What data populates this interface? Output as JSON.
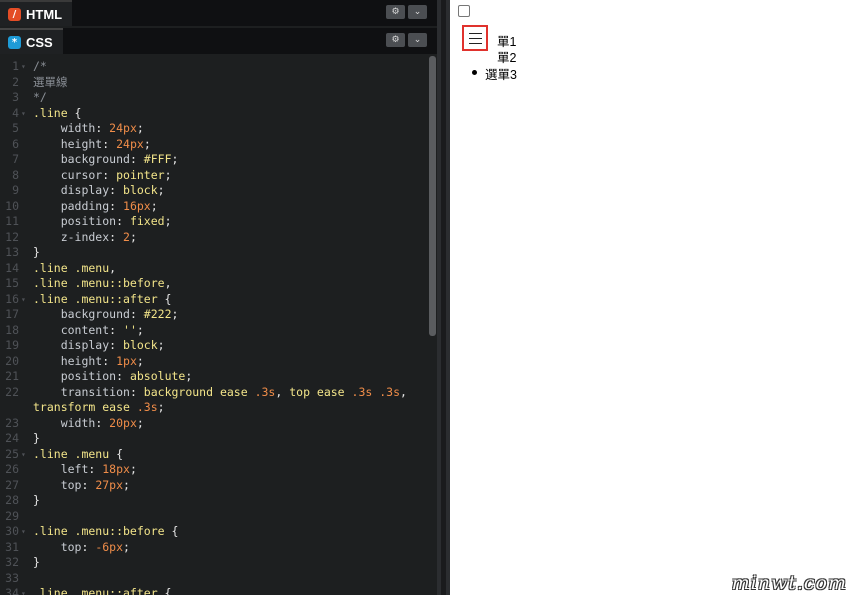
{
  "html_panel": {
    "tab_label": "HTML",
    "icon": "html-icon"
  },
  "css_panel": {
    "tab_label": "CSS",
    "icon": "css-icon"
  },
  "header_buttons": {
    "settings_icon": "gear-icon",
    "collapse_icon": "chevron-down-icon"
  },
  "code_lines": [
    {
      "n": "1",
      "fold": true,
      "parts": [
        {
          "t": "/*",
          "c": "c-comment"
        }
      ]
    },
    {
      "n": "2",
      "parts": [
        {
          "t": "選單線",
          "c": "c-comment"
        }
      ]
    },
    {
      "n": "3",
      "parts": [
        {
          "t": "*/",
          "c": "c-comment"
        }
      ]
    },
    {
      "n": "4",
      "fold": true,
      "parts": [
        {
          "t": ".line",
          "c": "c-sel"
        },
        {
          "t": " {",
          "c": "c-punc"
        }
      ]
    },
    {
      "n": "5",
      "parts": [
        {
          "t": "    width",
          "c": "c-prop"
        },
        {
          "t": ": ",
          "c": "c-punc"
        },
        {
          "t": "24px",
          "c": "c-num"
        },
        {
          "t": ";",
          "c": "c-punc"
        }
      ]
    },
    {
      "n": "6",
      "parts": [
        {
          "t": "    height",
          "c": "c-prop"
        },
        {
          "t": ": ",
          "c": "c-punc"
        },
        {
          "t": "24px",
          "c": "c-num"
        },
        {
          "t": ";",
          "c": "c-punc"
        }
      ]
    },
    {
      "n": "7",
      "parts": [
        {
          "t": "    background",
          "c": "c-prop"
        },
        {
          "t": ": ",
          "c": "c-punc"
        },
        {
          "t": "#FFF",
          "c": "c-val"
        },
        {
          "t": ";",
          "c": "c-punc"
        }
      ]
    },
    {
      "n": "8",
      "parts": [
        {
          "t": "    cursor",
          "c": "c-prop"
        },
        {
          "t": ": ",
          "c": "c-punc"
        },
        {
          "t": "pointer",
          "c": "c-val"
        },
        {
          "t": ";",
          "c": "c-punc"
        }
      ]
    },
    {
      "n": "9",
      "parts": [
        {
          "t": "    display",
          "c": "c-prop"
        },
        {
          "t": ": ",
          "c": "c-punc"
        },
        {
          "t": "block",
          "c": "c-val"
        },
        {
          "t": ";",
          "c": "c-punc"
        }
      ]
    },
    {
      "n": "10",
      "parts": [
        {
          "t": "    padding",
          "c": "c-prop"
        },
        {
          "t": ": ",
          "c": "c-punc"
        },
        {
          "t": "16px",
          "c": "c-num"
        },
        {
          "t": ";",
          "c": "c-punc"
        }
      ]
    },
    {
      "n": "11",
      "parts": [
        {
          "t": "    position",
          "c": "c-prop"
        },
        {
          "t": ": ",
          "c": "c-punc"
        },
        {
          "t": "fixed",
          "c": "c-val"
        },
        {
          "t": ";",
          "c": "c-punc"
        }
      ]
    },
    {
      "n": "12",
      "parts": [
        {
          "t": "    z-index",
          "c": "c-prop"
        },
        {
          "t": ": ",
          "c": "c-punc"
        },
        {
          "t": "2",
          "c": "c-num"
        },
        {
          "t": ";",
          "c": "c-punc"
        }
      ]
    },
    {
      "n": "13",
      "parts": [
        {
          "t": "}",
          "c": "c-punc"
        }
      ]
    },
    {
      "n": "14",
      "parts": [
        {
          "t": ".line .menu",
          "c": "c-sel"
        },
        {
          "t": ",",
          "c": "c-punc"
        }
      ]
    },
    {
      "n": "15",
      "parts": [
        {
          "t": ".line .menu::before",
          "c": "c-sel"
        },
        {
          "t": ",",
          "c": "c-punc"
        }
      ]
    },
    {
      "n": "16",
      "fold": true,
      "parts": [
        {
          "t": ".line .menu::after",
          "c": "c-sel"
        },
        {
          "t": " {",
          "c": "c-punc"
        }
      ]
    },
    {
      "n": "17",
      "parts": [
        {
          "t": "    background",
          "c": "c-prop"
        },
        {
          "t": ": ",
          "c": "c-punc"
        },
        {
          "t": "#222",
          "c": "c-val"
        },
        {
          "t": ";",
          "c": "c-punc"
        }
      ]
    },
    {
      "n": "18",
      "parts": [
        {
          "t": "    content",
          "c": "c-prop"
        },
        {
          "t": ": ",
          "c": "c-punc"
        },
        {
          "t": "''",
          "c": "c-val"
        },
        {
          "t": ";",
          "c": "c-punc"
        }
      ]
    },
    {
      "n": "19",
      "parts": [
        {
          "t": "    display",
          "c": "c-prop"
        },
        {
          "t": ": ",
          "c": "c-punc"
        },
        {
          "t": "block",
          "c": "c-val"
        },
        {
          "t": ";",
          "c": "c-punc"
        }
      ]
    },
    {
      "n": "20",
      "parts": [
        {
          "t": "    height",
          "c": "c-prop"
        },
        {
          "t": ": ",
          "c": "c-punc"
        },
        {
          "t": "1px",
          "c": "c-num"
        },
        {
          "t": ";",
          "c": "c-punc"
        }
      ]
    },
    {
      "n": "21",
      "parts": [
        {
          "t": "    position",
          "c": "c-prop"
        },
        {
          "t": ": ",
          "c": "c-punc"
        },
        {
          "t": "absolute",
          "c": "c-val"
        },
        {
          "t": ";",
          "c": "c-punc"
        }
      ]
    },
    {
      "n": "22",
      "parts": [
        {
          "t": "    transition",
          "c": "c-prop"
        },
        {
          "t": ": ",
          "c": "c-punc"
        },
        {
          "t": "background ease ",
          "c": "c-val"
        },
        {
          "t": ".3s",
          "c": "c-num"
        },
        {
          "t": ", ",
          "c": "c-punc"
        },
        {
          "t": "top ease ",
          "c": "c-val"
        },
        {
          "t": ".3s .3s",
          "c": "c-num"
        },
        {
          "t": ",",
          "c": "c-punc"
        }
      ]
    },
    {
      "n": "",
      "wrap": true,
      "parts": [
        {
          "t": "transform ease ",
          "c": "c-val"
        },
        {
          "t": ".3s",
          "c": "c-num"
        },
        {
          "t": ";",
          "c": "c-punc"
        }
      ]
    },
    {
      "n": "23",
      "parts": [
        {
          "t": "    width",
          "c": "c-prop"
        },
        {
          "t": ": ",
          "c": "c-punc"
        },
        {
          "t": "20px",
          "c": "c-num"
        },
        {
          "t": ";",
          "c": "c-punc"
        }
      ]
    },
    {
      "n": "24",
      "parts": [
        {
          "t": "}",
          "c": "c-punc"
        }
      ]
    },
    {
      "n": "25",
      "fold": true,
      "parts": [
        {
          "t": ".line .menu",
          "c": "c-sel"
        },
        {
          "t": " {",
          "c": "c-punc"
        }
      ]
    },
    {
      "n": "26",
      "parts": [
        {
          "t": "    left",
          "c": "c-prop"
        },
        {
          "t": ": ",
          "c": "c-punc"
        },
        {
          "t": "18px",
          "c": "c-num"
        },
        {
          "t": ";",
          "c": "c-punc"
        }
      ]
    },
    {
      "n": "27",
      "parts": [
        {
          "t": "    top",
          "c": "c-prop"
        },
        {
          "t": ": ",
          "c": "c-punc"
        },
        {
          "t": "27px",
          "c": "c-num"
        },
        {
          "t": ";",
          "c": "c-punc"
        }
      ]
    },
    {
      "n": "28",
      "parts": [
        {
          "t": "}",
          "c": "c-punc"
        }
      ]
    },
    {
      "n": "29",
      "parts": []
    },
    {
      "n": "30",
      "fold": true,
      "parts": [
        {
          "t": ".line .menu::before",
          "c": "c-sel"
        },
        {
          "t": " {",
          "c": "c-punc"
        }
      ]
    },
    {
      "n": "31",
      "parts": [
        {
          "t": "    top",
          "c": "c-prop"
        },
        {
          "t": ": ",
          "c": "c-punc"
        },
        {
          "t": "-6px",
          "c": "c-num"
        },
        {
          "t": ";",
          "c": "c-punc"
        }
      ]
    },
    {
      "n": "32",
      "parts": [
        {
          "t": "}",
          "c": "c-punc"
        }
      ]
    },
    {
      "n": "33",
      "parts": []
    },
    {
      "n": "34",
      "fold": true,
      "parts": [
        {
          "t": ".line .menu::after",
          "c": "c-sel"
        },
        {
          "t": " {",
          "c": "c-punc"
        }
      ]
    }
  ],
  "preview": {
    "menu_icon": "hamburger-icon",
    "items": [
      "單1",
      "單2",
      "選單3"
    ]
  },
  "watermark": "minwt.com"
}
